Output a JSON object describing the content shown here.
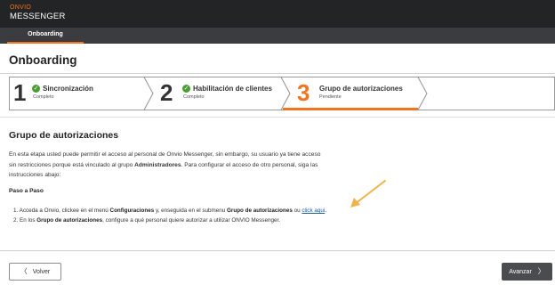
{
  "header": {
    "brand_top": "ONVIO",
    "brand_bottom": "MESSENGER",
    "tab": "Onboarding"
  },
  "page": {
    "title": "Onboarding"
  },
  "stepper": {
    "steps": [
      {
        "number": "1",
        "title": "Sincronización",
        "status": "Completo",
        "done": true
      },
      {
        "number": "2",
        "title": "Habilitación de clientes",
        "status": "Completo",
        "done": true
      },
      {
        "number": "3",
        "title": "Grupo de autorizaciones",
        "status": "Pendiente",
        "done": false
      }
    ]
  },
  "content": {
    "section_title": "Grupo de autorizaciones",
    "intro_1": "En esta etapa usted puede permitir el acceso al personal de Onvio Messenger, sin embargo, su usuario ya tiene acceso sin restricciones porque está vinculado al grupo ",
    "intro_bold": "Administradores",
    "intro_2": ". Para configurar el acceso de otro personal, siga las instrucciones abajo:",
    "paso_heading": "Paso a Paso",
    "step1_a": "1. Acceda a Onvio, clickee en el menú ",
    "step1_b": "Configuraciones",
    "step1_c": " y, enseguida en el submenu ",
    "step1_d": "Grupo de autorizaciones",
    "step1_e": " ou ",
    "step1_link": "click aqui",
    "step1_f": ".",
    "step2_a": "2. En los ",
    "step2_b": "Grupo de autorizaciones",
    "step2_c": ", configure a qué personal quiere autorizar a utilizar ONVIO Messenger."
  },
  "footer": {
    "back_label": "Volver",
    "next_label": "Avanzar"
  },
  "colors": {
    "accent": "#f2741f",
    "success": "#4a9d33",
    "header_bg": "#222426",
    "link": "#1a5fa6"
  }
}
